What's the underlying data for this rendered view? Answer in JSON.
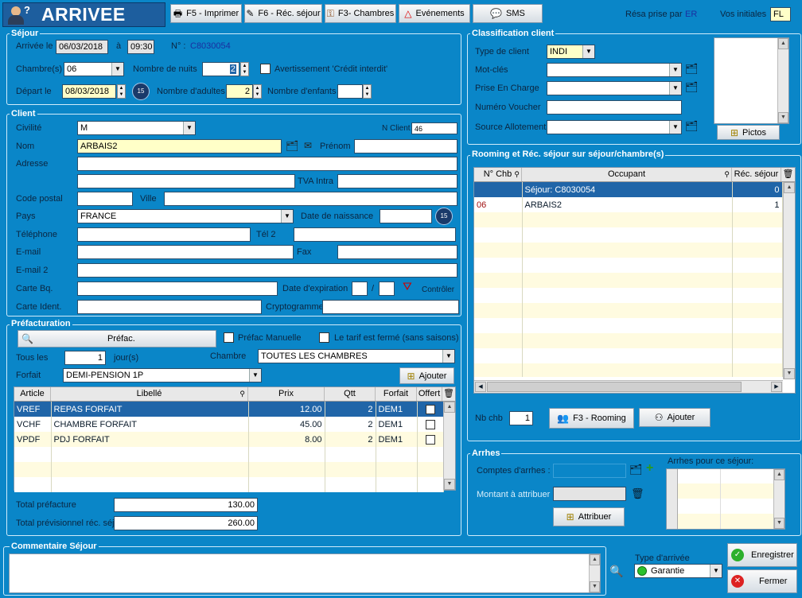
{
  "window": {
    "title": "ARRIVEE"
  },
  "toolbar": {
    "print": "F5 - Imprimer",
    "rec_sejour": "F6 - Réc. séjour",
    "chambres": "F3- Chambres",
    "evenements": "Evénements",
    "sms": "SMS",
    "resa_label": "Résa prise par",
    "resa_value": "ER",
    "initiales_label": "Vos initiales",
    "initiales_value": "FL"
  },
  "sejour": {
    "title": "Séjour",
    "arrivee_label": "Arrivée le",
    "arrivee_date": "06/03/2018",
    "a_label": "à",
    "arrivee_time": "09:30",
    "num_label": "N° :",
    "num_value": "C8030054",
    "chambres_label": "Chambre(s)",
    "chambres_value": "06",
    "nuits_label": "Nombre de nuits",
    "nuits_value": "2",
    "credit_label": "Avertissement 'Crédit interdit'",
    "depart_label": "Départ le",
    "depart_date": "08/03/2018",
    "adultes_label": "Nombre d'adultes",
    "adultes_value": "2",
    "enfants_label": "Nombre d'enfants",
    "enfants_value": ""
  },
  "client": {
    "title": "Client",
    "civilite_label": "Civilité",
    "civilite_value": "M",
    "nclient_label": "N Client",
    "nclient_value": "46",
    "nom_label": "Nom",
    "nom_value": "ARBAIS2",
    "prenom_label": "Prénom",
    "prenom_value": "",
    "adresse_label": "Adresse",
    "tva_label": "TVA Intra",
    "cp_label": "Code postal",
    "ville_label": "Ville",
    "pays_label": "Pays",
    "pays_value": "FRANCE",
    "naissance_label": "Date de naissance",
    "tel_label": "Téléphone",
    "tel2_label": "Tél 2",
    "email_label": "E-mail",
    "fax_label": "Fax",
    "email2_label": "E-mail 2",
    "cartebq_label": "Carte Bq.",
    "expiration_label": "Date d'expiration",
    "slash": "/",
    "controler_label": "Contrôler",
    "carteident_label": "Carte Ident.",
    "crypto_label": "Cryptogramme"
  },
  "prefacturation": {
    "title": "Préfacturation",
    "prefac_btn": "Préfac.",
    "manuelle_label": "Préfac Manuelle",
    "tarif_label": "Le tarif est fermé (sans saisons)",
    "tousles_label": "Tous les",
    "tousles_value": "1",
    "jours_label": "jour(s)",
    "chambre_label": "Chambre",
    "chambre_value": "TOUTES LES CHAMBRES",
    "forfait_label": "Forfait",
    "forfait_value": "DEMI-PENSION 1P",
    "ajouter_btn": "Ajouter",
    "columns": [
      "Article",
      "Libellé",
      "Prix",
      "Qtt",
      "Forfait",
      "Offert"
    ],
    "rows": [
      {
        "article": "VREF",
        "libelle": "REPAS FORFAIT",
        "prix": "12.00",
        "qtt": "2",
        "forfait": "DEM1"
      },
      {
        "article": "VCHF",
        "libelle": "CHAMBRE FORFAIT",
        "prix": "45.00",
        "qtt": "2",
        "forfait": "DEM1"
      },
      {
        "article": "VPDF",
        "libelle": "PDJ FORFAIT",
        "prix": "8.00",
        "qtt": "2",
        "forfait": "DEM1"
      }
    ],
    "total_prefacture_label": "Total préfacture",
    "total_prefacture_value": "130.00",
    "total_prev_label": "Total prévisionnel réc. séjour",
    "total_prev_value": "260.00"
  },
  "classification": {
    "title": "Classification client",
    "type_label": "Type de client",
    "type_value": "INDI",
    "motcles_label": "Mot-clés",
    "priseencharge_label": "Prise En Charge",
    "voucher_label": "Numéro Voucher",
    "source_label": "Source Allotement",
    "pictos_btn": "Pictos"
  },
  "rooming": {
    "title": "Rooming et Réc. séjour sur séjour/chambre(s)",
    "columns": [
      "N° Chb",
      "Occupant",
      "Réc. séjour"
    ],
    "rows": [
      {
        "chb": "",
        "occupant": "Séjour: C8030054",
        "rec": "0"
      },
      {
        "chb": "06",
        "occupant": "ARBAIS2",
        "rec": "1"
      }
    ],
    "nbchb_label": "Nb chb",
    "nbchb_value": "1",
    "f3_rooming_btn": "F3 - Rooming",
    "ajouter_btn": "Ajouter"
  },
  "arrhes": {
    "title": "Arrhes",
    "comptes_label": "Comptes d'arrhes :",
    "montant_label": "Montant à attribuer",
    "attribuer_btn": "Attribuer",
    "pour_sejour_label": "Arrhes pour ce séjour:"
  },
  "commentaire": {
    "title": "Commentaire Séjour"
  },
  "footer": {
    "type_arrivee_label": "Type d'arrivée",
    "type_arrivee_value": "Garantie",
    "enregistrer_btn": "Enregistrer",
    "fermer_btn": "Fermer"
  }
}
